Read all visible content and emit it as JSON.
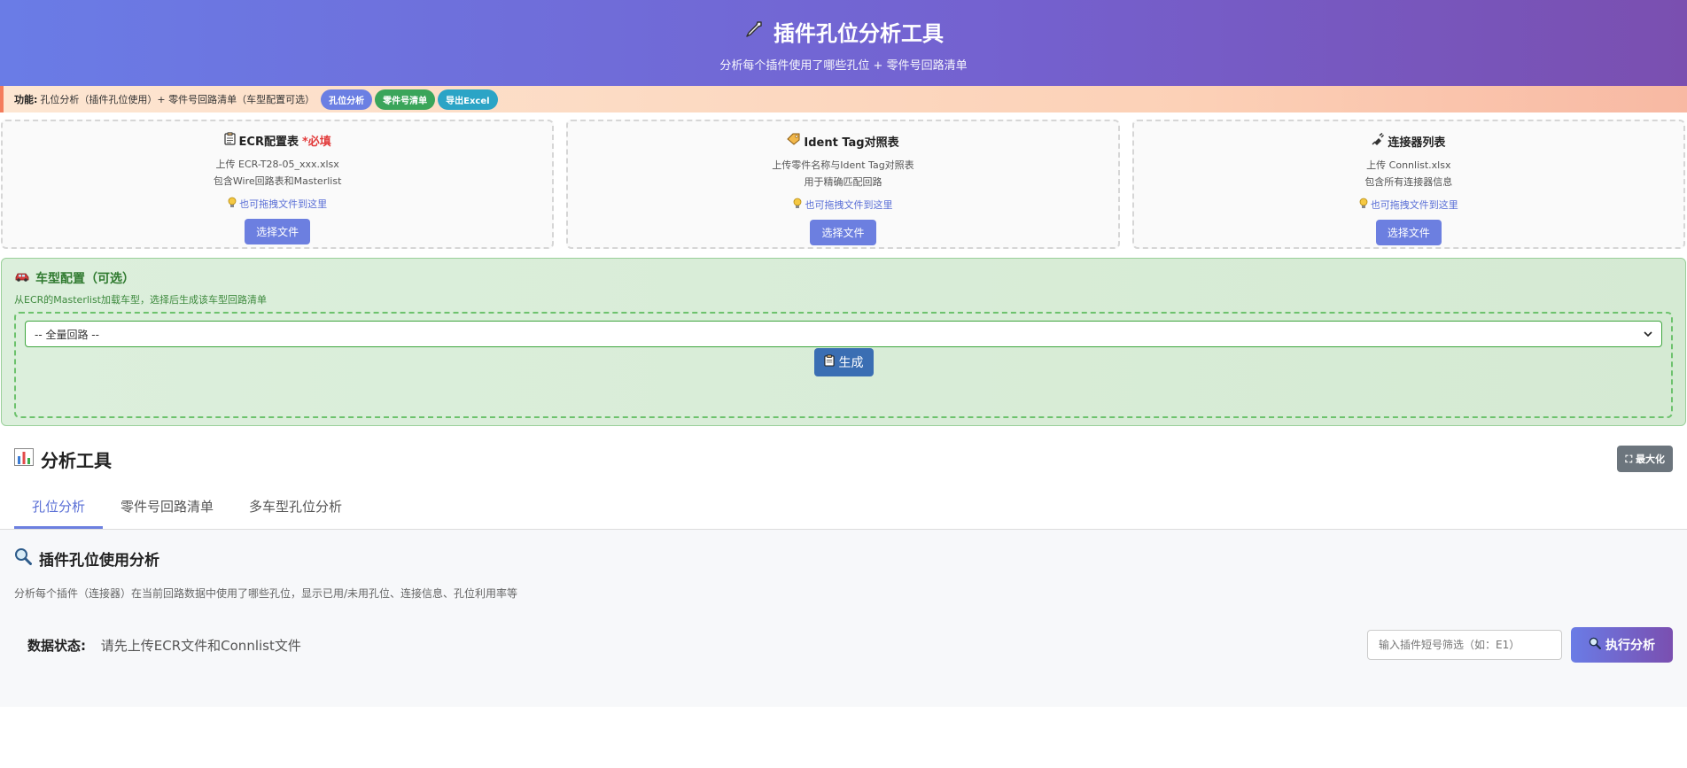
{
  "header": {
    "title": "插件孔位分析工具",
    "subtitle": "分析每个插件使用了哪些孔位 + 零件号回路清单"
  },
  "feature_bar": {
    "label": "功能:",
    "description": "孔位分析（插件孔位使用）+ 零件号回路清单（车型配置可选）",
    "pills": [
      "孔位分析",
      "零件号清单",
      "导出Excel"
    ]
  },
  "upload_cards": [
    {
      "title": "ECR配置表",
      "required": "*必填",
      "line1": "上传 ECR-T28-05_xxx.xlsx",
      "line2": "包含Wire回路表和Masterlist",
      "hint": "也可拖拽文件到这里",
      "button": "选择文件"
    },
    {
      "title": "Ident Tag对照表",
      "required": "",
      "line1": "上传零件名称与Ident Tag对照表",
      "line2": "用于精确匹配回路",
      "hint": "也可拖拽文件到这里",
      "button": "选择文件"
    },
    {
      "title": "连接器列表",
      "required": "",
      "line1": "上传 Connlist.xlsx",
      "line2": "包含所有连接器信息",
      "hint": "也可拖拽文件到这里",
      "button": "选择文件"
    }
  ],
  "vehicle": {
    "title": "车型配置（可选）",
    "description": "从ECR的Masterlist加载车型，选择后生成该车型回路清单",
    "select_value": "-- 全量回路 --",
    "generate_button": "生成"
  },
  "tools": {
    "title": "分析工具",
    "maximize_button": "最大化",
    "tabs": [
      "孔位分析",
      "零件号回路清单",
      "多车型孔位分析"
    ]
  },
  "panel": {
    "title": "插件孔位使用分析",
    "description": "分析每个插件（连接器）在当前回路数据中使用了哪些孔位，显示已用/未用孔位、连接信息、孔位利用率等",
    "status_label": "数据状态:",
    "status_value": "请先上传ECR文件和Connlist文件",
    "filter_placeholder": "输入插件短号筛选（如：E1）",
    "run_button": "执行分析"
  }
}
